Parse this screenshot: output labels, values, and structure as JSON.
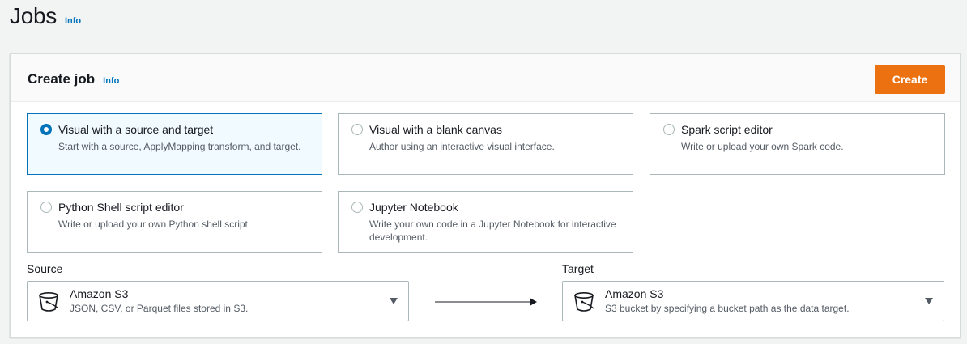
{
  "page": {
    "title": "Jobs",
    "info_label": "Info"
  },
  "create_job": {
    "title": "Create job",
    "info_label": "Info",
    "create_button": "Create",
    "options": [
      {
        "title": "Visual with a source and target",
        "description": "Start with a source, ApplyMapping transform, and target.",
        "selected": true
      },
      {
        "title": "Visual with a blank canvas",
        "description": "Author using an interactive visual interface.",
        "selected": false
      },
      {
        "title": "Spark script editor",
        "description": "Write or upload your own Spark code.",
        "selected": false
      },
      {
        "title": "Python Shell script editor",
        "description": "Write or upload your own Python shell script.",
        "selected": false
      },
      {
        "title": "Jupyter Notebook",
        "description": "Write your own code in a Jupyter Notebook for interactive development.",
        "selected": false
      }
    ],
    "source": {
      "label": "Source",
      "value": "Amazon S3",
      "description": "JSON, CSV, or Parquet files stored in S3.",
      "icon": "s3-bucket-icon"
    },
    "target": {
      "label": "Target",
      "value": "Amazon S3",
      "description": "S3 bucket by specifying a bucket path as the data target.",
      "icon": "s3-bucket-icon"
    }
  },
  "colors": {
    "accent": "#0073bb",
    "primary_button": "#ec7211",
    "selected_tile_bg": "#f1faff"
  }
}
